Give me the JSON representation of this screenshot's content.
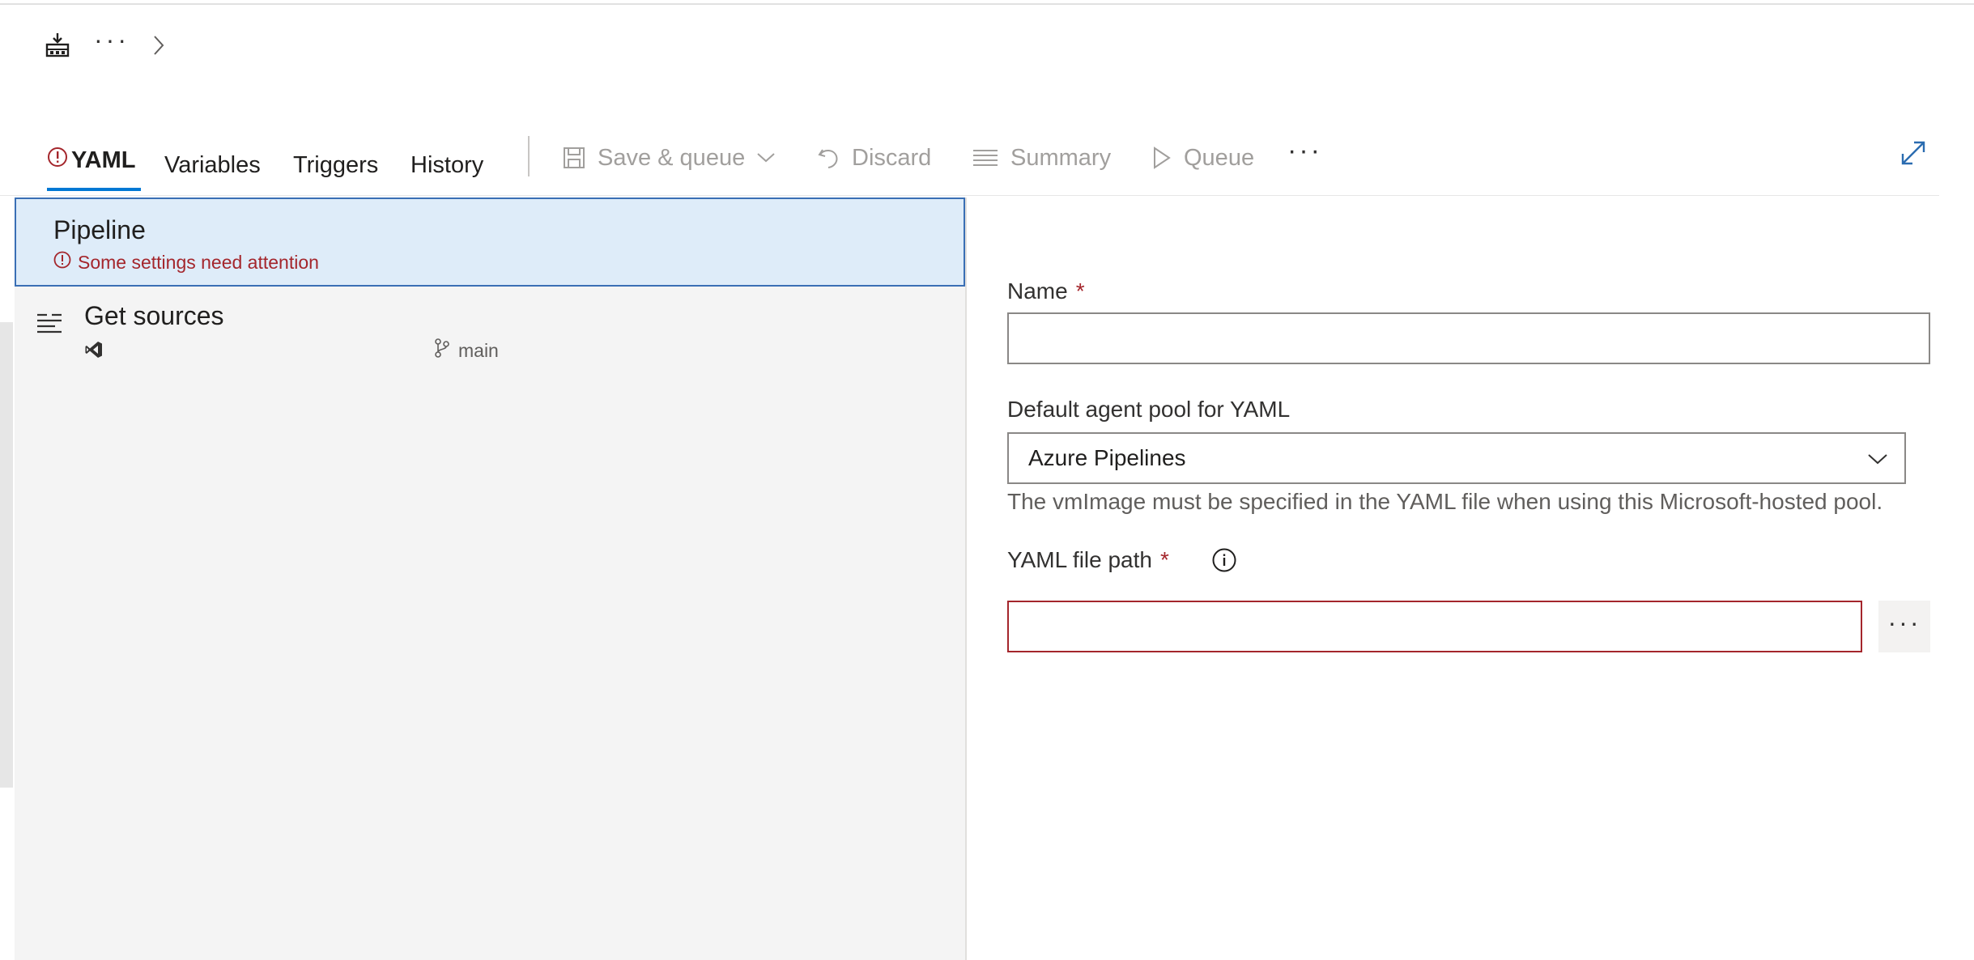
{
  "breadcrumb": {
    "more": "···",
    "pipeline_icon": "pipeline-icon",
    "separator_icon": "chevron-right-icon"
  },
  "tabs": [
    {
      "label": "YAML",
      "active": true,
      "warning": true
    },
    {
      "label": "Variables"
    },
    {
      "label": "Triggers"
    },
    {
      "label": "History"
    }
  ],
  "toolbar": {
    "save_queue": "Save & queue",
    "discard": "Discard",
    "summary": "Summary",
    "queue": "Queue",
    "more": "···"
  },
  "left_panel": {
    "pipeline": {
      "title": "Pipeline",
      "warning": "Some settings need attention"
    },
    "get_sources": {
      "title": "Get sources",
      "branch": "main"
    }
  },
  "form": {
    "name_label": "Name",
    "name_value": "",
    "required_mark": "*",
    "agent_pool_label": "Default agent pool for YAML",
    "agent_pool_value": "Azure Pipelines",
    "agent_pool_helper": "The vmImage must be specified in the YAML file when using this Microsoft-hosted pool.",
    "yaml_path_label": "YAML file path",
    "yaml_path_value": "",
    "browse": "···"
  },
  "colors": {
    "accent": "#0078d4",
    "error": "#a4262c",
    "selected_bg": "#deecf9"
  }
}
